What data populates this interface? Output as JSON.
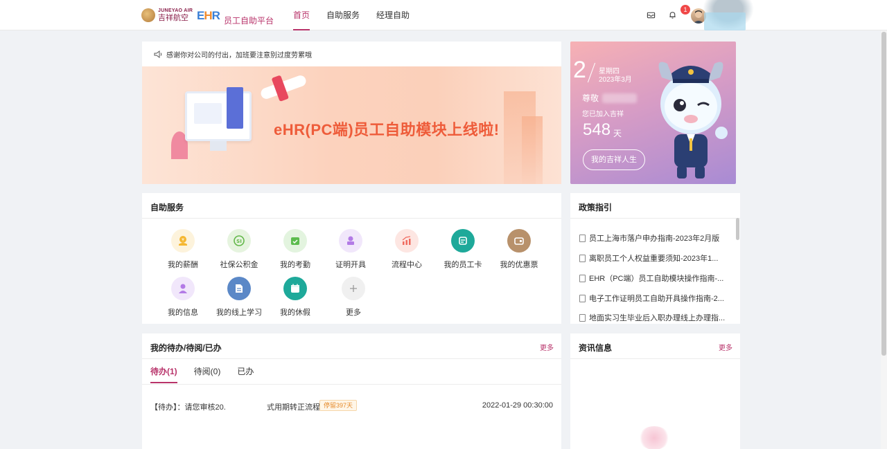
{
  "header": {
    "logo_en": "JUNEYAO AIR",
    "logo_cn": "吉祥航空",
    "ehr_logo": "EHR",
    "platform_title": "员工自助平台",
    "nav": [
      {
        "label": "首页",
        "active": true
      },
      {
        "label": "自助服务",
        "active": false
      },
      {
        "label": "经理自助",
        "active": false
      }
    ],
    "notification_count": "1",
    "icons": [
      "mail-icon",
      "bell-icon"
    ]
  },
  "notice": {
    "icon": "speaker-icon",
    "text": "感谢你对公司的付出，加班要注意别过度劳累哦"
  },
  "banner": {
    "title": "eHR(PC端)员工自助模块上线啦!"
  },
  "profile": {
    "day": "2",
    "weekday": "星期四",
    "year_month": "2023年3月",
    "greeting": "尊敬",
    "joined_text": "您已加入吉祥",
    "days": "548",
    "days_unit": "天",
    "life_button": "我的吉祥人生"
  },
  "self_service": {
    "title": "自助服务",
    "items": [
      {
        "label": "我的薪酬",
        "icon": "salary-icon",
        "color": "#f5b731",
        "bg": "#fdf3dc"
      },
      {
        "label": "社保公积金",
        "icon": "social-security-icon",
        "color": "#63b84a",
        "bg": "#e6f4df"
      },
      {
        "label": "我的考勤",
        "icon": "attendance-icon",
        "color": "#5cbc4e",
        "bg": "#e3f4df"
      },
      {
        "label": "证明开具",
        "icon": "certificate-icon",
        "color": "#b37be6",
        "bg": "#f1e7fb"
      },
      {
        "label": "流程中心",
        "icon": "process-icon",
        "color": "#f06a5e",
        "bg": "#fde6e2"
      },
      {
        "label": "我的员工卡",
        "icon": "employee-card-icon",
        "color": "#ffffff",
        "bg": "#1ea99a"
      },
      {
        "label": "我的优惠票",
        "icon": "discount-ticket-icon",
        "color": "#ffffff",
        "bg": "#b8916b"
      },
      {
        "label": "我的信息",
        "icon": "profile-icon",
        "color": "#b37be6",
        "bg": "#f1e7fb"
      },
      {
        "label": "我的线上学习",
        "icon": "learning-icon",
        "color": "#ffffff",
        "bg": "#5b88c7"
      },
      {
        "label": "我的休假",
        "icon": "vacation-icon",
        "color": "#ffffff",
        "bg": "#1ea99a"
      },
      {
        "label": "更多",
        "icon": "plus-icon",
        "color": "#999999",
        "bg": "#f0f0f0"
      }
    ]
  },
  "policy": {
    "title": "政策指引",
    "items": [
      "员工上海市落户申办指南-2023年2月版",
      "离职员工个人权益重要须知-2023年1...",
      "EHR（PC端）员工自助模块操作指南-...",
      "电子工作证明员工自助开具操作指南-2...",
      "地面实习生毕业后入职办理线上办理指..."
    ]
  },
  "todo": {
    "title": "我的待办/待阅/已办",
    "more": "更多",
    "tabs": [
      {
        "label": "待办(1)",
        "active": true
      },
      {
        "label": "待阅(0)",
        "active": false
      },
      {
        "label": "已办",
        "active": false
      }
    ],
    "rows": [
      {
        "prefix": "【待办】：请您审核20.",
        "name": "式用期转正流程",
        "tag": "停留397天",
        "time": "2022-01-29 00:30:00"
      }
    ]
  },
  "news": {
    "title": "资讯信息",
    "more": "更多"
  },
  "colors": {
    "brand": "#b8336a",
    "banner_title": "#ee5c3a",
    "badge": "#f04848"
  }
}
